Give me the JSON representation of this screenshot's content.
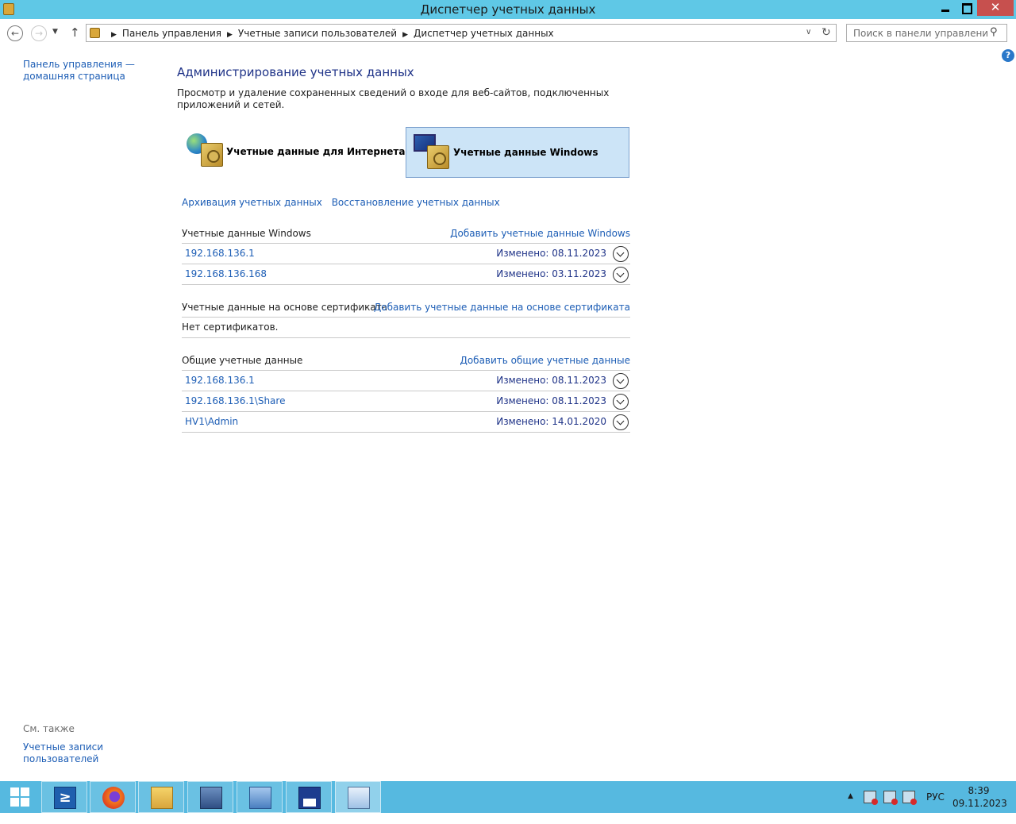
{
  "window": {
    "title": "Диспетчер учетных данных",
    "close_glyph": "✕"
  },
  "address": {
    "crumbs": [
      "Панель управления",
      "Учетные записи пользователей",
      "Диспетчер учетных данных"
    ],
    "search_placeholder": "Поиск в панели управления"
  },
  "sidebar": {
    "home_link": "Панель управления — домашняя страница",
    "see_also": "См. также",
    "users_link": "Учетные записи пользователей"
  },
  "main": {
    "title": "Администрирование учетных данных",
    "description": "Просмотр и удаление сохраненных сведений о входе для веб-сайтов, подключенных приложений и сетей.",
    "tiles": {
      "web": "Учетные данные для Интернета",
      "windows": "Учетные данные Windows"
    },
    "links": {
      "backup": "Архивация учетных данных",
      "restore": "Восстановление учетных данных"
    },
    "windows_section": {
      "header": "Учетные данные Windows",
      "add": "Добавить учетные данные Windows",
      "rows": [
        {
          "name": "192.168.136.1",
          "modified": "Изменено:  08.11.2023"
        },
        {
          "name": "192.168.136.168",
          "modified": "Изменено:  03.11.2023"
        }
      ]
    },
    "cert_section": {
      "header": "Учетные данные на основе сертификата",
      "add": "Добавить учетные данные на основе сертификата",
      "empty": "Нет сертификатов."
    },
    "generic_section": {
      "header": "Общие учетные данные",
      "add": "Добавить общие учетные данные",
      "rows": [
        {
          "name": "192.168.136.1",
          "modified": "Изменено:  08.11.2023"
        },
        {
          "name": "192.168.136.1\\Share",
          "modified": "Изменено:  08.11.2023"
        },
        {
          "name": "HV1\\Admin",
          "modified": "Изменено:  14.01.2020"
        }
      ]
    }
  },
  "taskbar": {
    "language": "РУС",
    "time": "8:39",
    "date": "09.11.2023"
  },
  "colors": {
    "titlebar": "#5fc8e6",
    "taskbar": "#56b9e0",
    "link": "#1c5db5",
    "heading": "#1e3287",
    "selected_tile": "#cce4f7"
  }
}
